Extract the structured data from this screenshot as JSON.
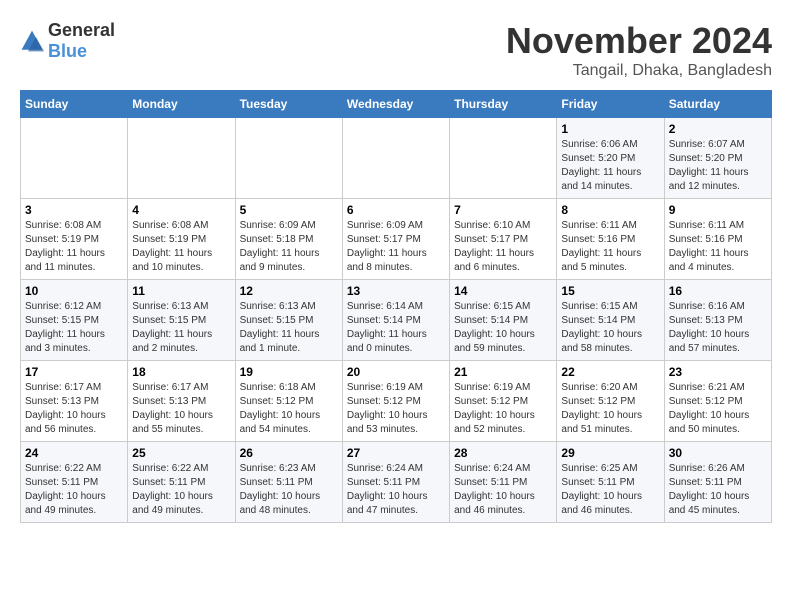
{
  "logo": {
    "general": "General",
    "blue": "Blue"
  },
  "header": {
    "month": "November 2024",
    "location": "Tangail, Dhaka, Bangladesh"
  },
  "weekdays": [
    "Sunday",
    "Monday",
    "Tuesday",
    "Wednesday",
    "Thursday",
    "Friday",
    "Saturday"
  ],
  "weeks": [
    [
      {
        "day": "",
        "info": ""
      },
      {
        "day": "",
        "info": ""
      },
      {
        "day": "",
        "info": ""
      },
      {
        "day": "",
        "info": ""
      },
      {
        "day": "",
        "info": ""
      },
      {
        "day": "1",
        "info": "Sunrise: 6:06 AM\nSunset: 5:20 PM\nDaylight: 11 hours and 14 minutes."
      },
      {
        "day": "2",
        "info": "Sunrise: 6:07 AM\nSunset: 5:20 PM\nDaylight: 11 hours and 12 minutes."
      }
    ],
    [
      {
        "day": "3",
        "info": "Sunrise: 6:08 AM\nSunset: 5:19 PM\nDaylight: 11 hours and 11 minutes."
      },
      {
        "day": "4",
        "info": "Sunrise: 6:08 AM\nSunset: 5:19 PM\nDaylight: 11 hours and 10 minutes."
      },
      {
        "day": "5",
        "info": "Sunrise: 6:09 AM\nSunset: 5:18 PM\nDaylight: 11 hours and 9 minutes."
      },
      {
        "day": "6",
        "info": "Sunrise: 6:09 AM\nSunset: 5:17 PM\nDaylight: 11 hours and 8 minutes."
      },
      {
        "day": "7",
        "info": "Sunrise: 6:10 AM\nSunset: 5:17 PM\nDaylight: 11 hours and 6 minutes."
      },
      {
        "day": "8",
        "info": "Sunrise: 6:11 AM\nSunset: 5:16 PM\nDaylight: 11 hours and 5 minutes."
      },
      {
        "day": "9",
        "info": "Sunrise: 6:11 AM\nSunset: 5:16 PM\nDaylight: 11 hours and 4 minutes."
      }
    ],
    [
      {
        "day": "10",
        "info": "Sunrise: 6:12 AM\nSunset: 5:15 PM\nDaylight: 11 hours and 3 minutes."
      },
      {
        "day": "11",
        "info": "Sunrise: 6:13 AM\nSunset: 5:15 PM\nDaylight: 11 hours and 2 minutes."
      },
      {
        "day": "12",
        "info": "Sunrise: 6:13 AM\nSunset: 5:15 PM\nDaylight: 11 hours and 1 minute."
      },
      {
        "day": "13",
        "info": "Sunrise: 6:14 AM\nSunset: 5:14 PM\nDaylight: 11 hours and 0 minutes."
      },
      {
        "day": "14",
        "info": "Sunrise: 6:15 AM\nSunset: 5:14 PM\nDaylight: 10 hours and 59 minutes."
      },
      {
        "day": "15",
        "info": "Sunrise: 6:15 AM\nSunset: 5:14 PM\nDaylight: 10 hours and 58 minutes."
      },
      {
        "day": "16",
        "info": "Sunrise: 6:16 AM\nSunset: 5:13 PM\nDaylight: 10 hours and 57 minutes."
      }
    ],
    [
      {
        "day": "17",
        "info": "Sunrise: 6:17 AM\nSunset: 5:13 PM\nDaylight: 10 hours and 56 minutes."
      },
      {
        "day": "18",
        "info": "Sunrise: 6:17 AM\nSunset: 5:13 PM\nDaylight: 10 hours and 55 minutes."
      },
      {
        "day": "19",
        "info": "Sunrise: 6:18 AM\nSunset: 5:12 PM\nDaylight: 10 hours and 54 minutes."
      },
      {
        "day": "20",
        "info": "Sunrise: 6:19 AM\nSunset: 5:12 PM\nDaylight: 10 hours and 53 minutes."
      },
      {
        "day": "21",
        "info": "Sunrise: 6:19 AM\nSunset: 5:12 PM\nDaylight: 10 hours and 52 minutes."
      },
      {
        "day": "22",
        "info": "Sunrise: 6:20 AM\nSunset: 5:12 PM\nDaylight: 10 hours and 51 minutes."
      },
      {
        "day": "23",
        "info": "Sunrise: 6:21 AM\nSunset: 5:12 PM\nDaylight: 10 hours and 50 minutes."
      }
    ],
    [
      {
        "day": "24",
        "info": "Sunrise: 6:22 AM\nSunset: 5:11 PM\nDaylight: 10 hours and 49 minutes."
      },
      {
        "day": "25",
        "info": "Sunrise: 6:22 AM\nSunset: 5:11 PM\nDaylight: 10 hours and 49 minutes."
      },
      {
        "day": "26",
        "info": "Sunrise: 6:23 AM\nSunset: 5:11 PM\nDaylight: 10 hours and 48 minutes."
      },
      {
        "day": "27",
        "info": "Sunrise: 6:24 AM\nSunset: 5:11 PM\nDaylight: 10 hours and 47 minutes."
      },
      {
        "day": "28",
        "info": "Sunrise: 6:24 AM\nSunset: 5:11 PM\nDaylight: 10 hours and 46 minutes."
      },
      {
        "day": "29",
        "info": "Sunrise: 6:25 AM\nSunset: 5:11 PM\nDaylight: 10 hours and 46 minutes."
      },
      {
        "day": "30",
        "info": "Sunrise: 6:26 AM\nSunset: 5:11 PM\nDaylight: 10 hours and 45 minutes."
      }
    ]
  ]
}
